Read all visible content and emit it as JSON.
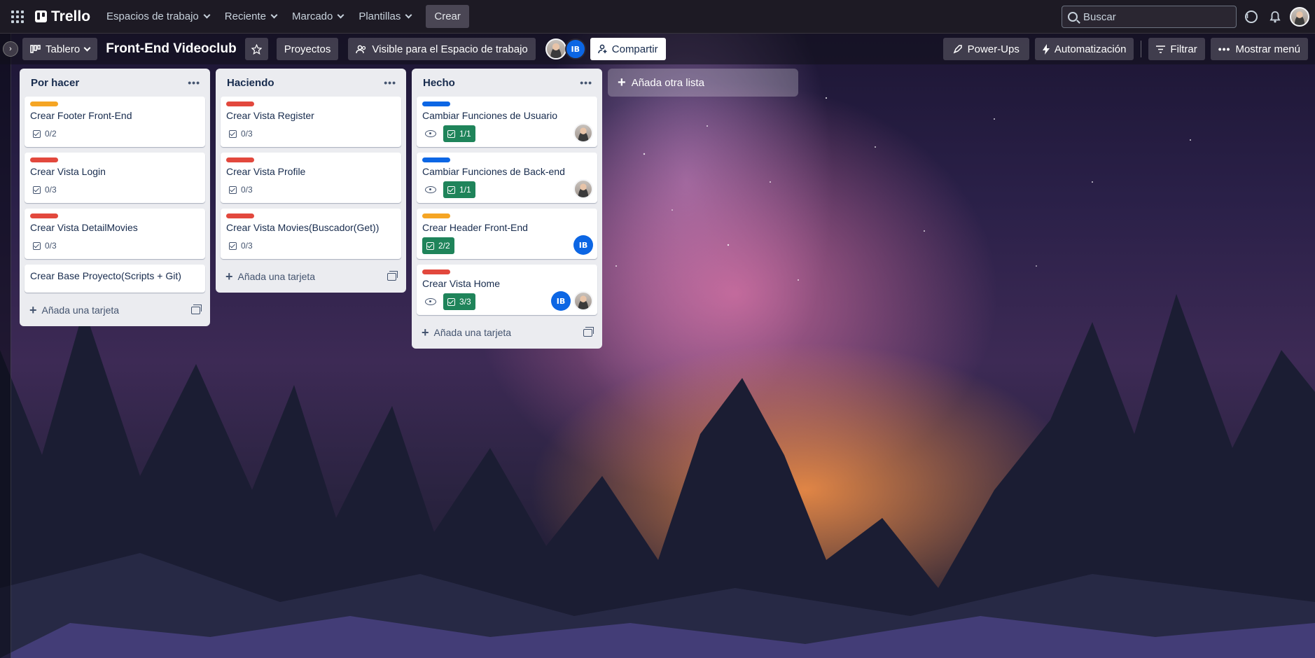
{
  "colors": {
    "orange": "#f5a524",
    "red": "#e2483d",
    "blue": "#0c66e4",
    "done_green": "#1f845a"
  },
  "topnav": {
    "brand": "Trello",
    "menus": [
      "Espacios de trabajo",
      "Reciente",
      "Marcado",
      "Plantillas"
    ],
    "create": "Crear",
    "search_placeholder": "Buscar",
    "icons": [
      "apps-grid-icon",
      "info-icon",
      "bell-icon",
      "user-avatar"
    ]
  },
  "board": {
    "view": "Tablero",
    "title": "Front-End Videoclub",
    "workspace": "Proyectos",
    "visibility": "Visible para el Espacio de trabajo",
    "member_initials": "IB",
    "share": "Compartir",
    "powerups": "Power-Ups",
    "automation": "Automatización",
    "filter": "Filtrar",
    "menu": "Mostrar menú"
  },
  "lists": [
    {
      "title": "Por hacer",
      "add": "Añada una tarjeta",
      "cards": [
        {
          "label": "orange",
          "title": "Crear Footer Front-End",
          "checklist": "0/2"
        },
        {
          "label": "red",
          "title": "Crear Vista Login",
          "checklist": "0/3"
        },
        {
          "label": "red",
          "title": "Crear Vista DetailMovies",
          "checklist": "0/3"
        },
        {
          "title": "Crear Base Proyecto(Scripts + Git)"
        }
      ]
    },
    {
      "title": "Haciendo",
      "add": "Añada una tarjeta",
      "cards": [
        {
          "label": "red",
          "title": "Crear Vista Register",
          "checklist": "0/3"
        },
        {
          "label": "red",
          "title": "Crear Vista Profile",
          "checklist": "0/3"
        },
        {
          "label": "red",
          "title": "Crear Vista Movies(Buscador(Get))",
          "checklist": "0/3"
        }
      ]
    },
    {
      "title": "Hecho",
      "add": "Añada una tarjeta",
      "cards": [
        {
          "label": "blue",
          "title": "Cambiar Funciones de Usuario",
          "checklist": "1/1",
          "watching": true,
          "members": [
            "photo"
          ]
        },
        {
          "label": "blue",
          "title": "Cambiar Funciones de Back-end",
          "checklist": "1/1",
          "watching": true,
          "members": [
            "photo"
          ]
        },
        {
          "label": "orange",
          "title": "Crear Header Front-End",
          "checklist": "2/2",
          "members": [
            "IB"
          ]
        },
        {
          "label": "red",
          "title": "Crear Vista Home",
          "checklist": "3/3",
          "watching": true,
          "members": [
            "IB",
            "photo"
          ]
        }
      ]
    }
  ],
  "add_list": "Añada otra lista"
}
